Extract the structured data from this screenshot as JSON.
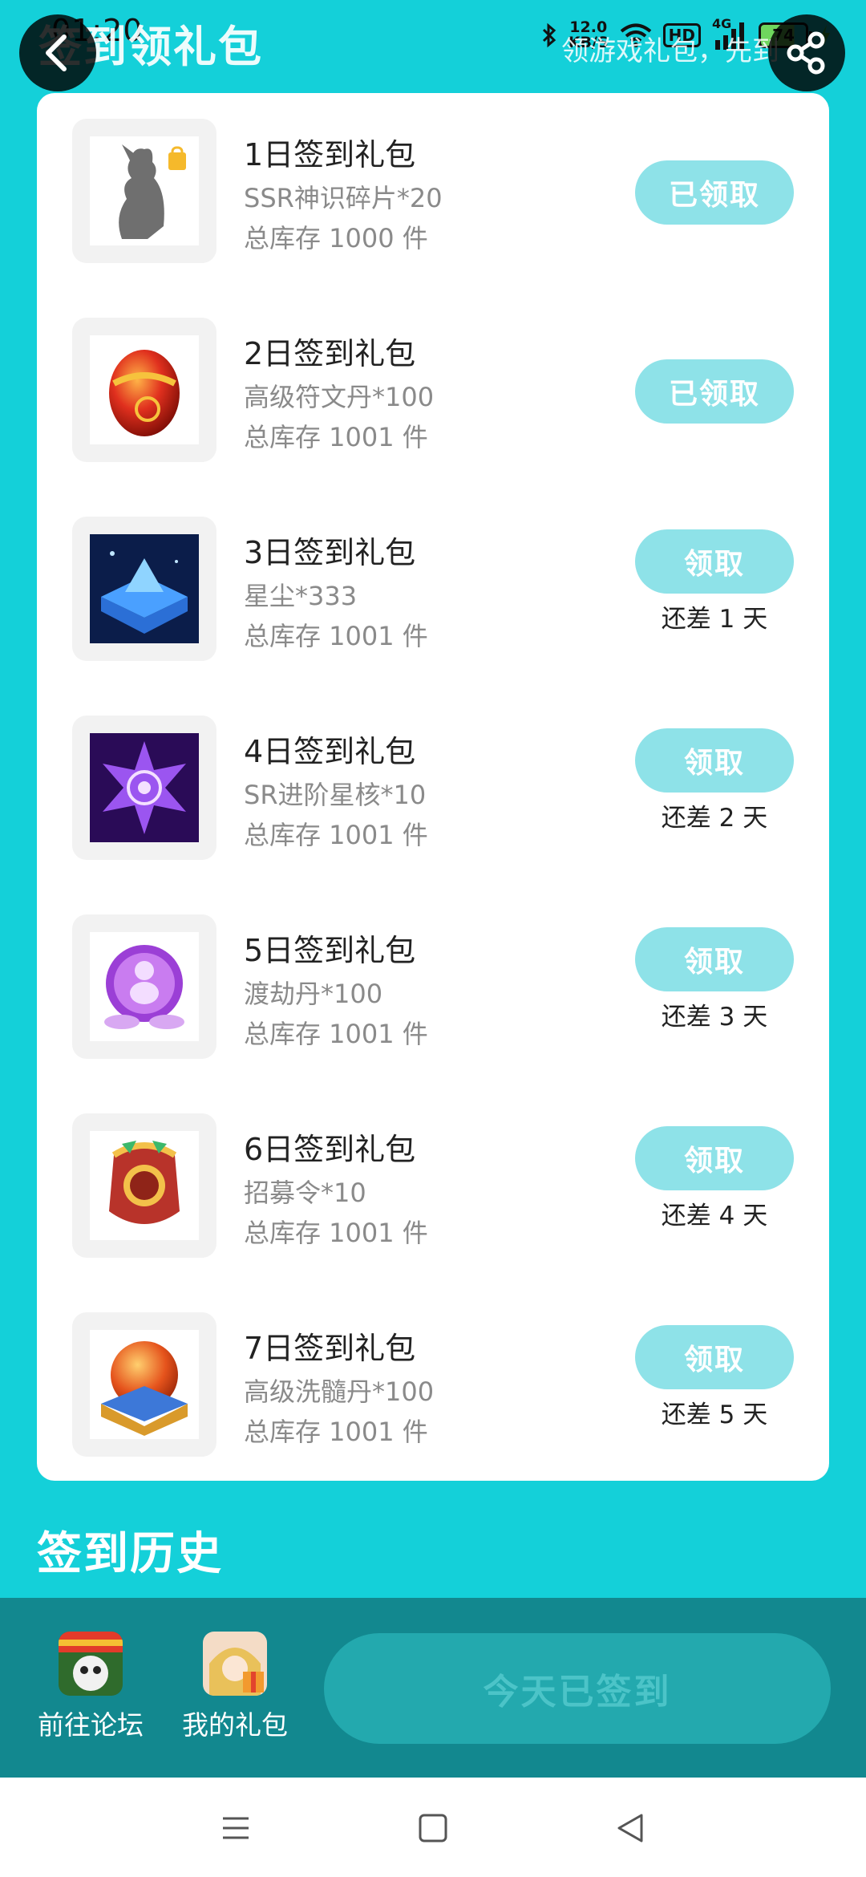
{
  "status_bar": {
    "time": "01:20",
    "net_speed_value": "12.0",
    "net_speed_unit": "KB/S",
    "hd_label": "HD",
    "network_type": "4G",
    "battery": "74"
  },
  "header": {
    "title": "签到领礼包",
    "hint": "领游戏礼包，先到"
  },
  "gifts": [
    {
      "name": "1日签到礼包",
      "item": "SSR神识碎片*20",
      "stock": "总库存 1000 件",
      "button": "已领取",
      "days": ""
    },
    {
      "name": "2日签到礼包",
      "item": "高级符文丹*100",
      "stock": "总库存 1001 件",
      "button": "已领取",
      "days": ""
    },
    {
      "name": "3日签到礼包",
      "item": "星尘*333",
      "stock": "总库存 1001 件",
      "button": "领取",
      "days": "还差 1 天"
    },
    {
      "name": "4日签到礼包",
      "item": "SR进阶星核*10",
      "stock": "总库存 1001 件",
      "button": "领取",
      "days": "还差 2 天"
    },
    {
      "name": "5日签到礼包",
      "item": "渡劫丹*100",
      "stock": "总库存 1001 件",
      "button": "领取",
      "days": "还差 3 天"
    },
    {
      "name": "6日签到礼包",
      "item": "招募令*10",
      "stock": "总库存 1001 件",
      "button": "领取",
      "days": "还差 4 天"
    },
    {
      "name": "7日签到礼包",
      "item": "高级洗髓丹*100",
      "stock": "总库存 1001 件",
      "button": "领取",
      "days": "还差 5 天"
    }
  ],
  "history": {
    "title": "签到历史"
  },
  "action_bar": {
    "forum_label": "前往论坛",
    "my_gifts_label": "我的礼包",
    "signed_button": "今天已签到"
  },
  "icons": {
    "back": "back-arrow-icon",
    "share": "share-icon",
    "nav_menu": "menu-icon",
    "nav_home": "home-icon",
    "nav_back": "back-triangle-icon"
  },
  "colors": {
    "background": "#14d0d9",
    "button": "#8ee2e8",
    "action_bar": "#12888f"
  }
}
